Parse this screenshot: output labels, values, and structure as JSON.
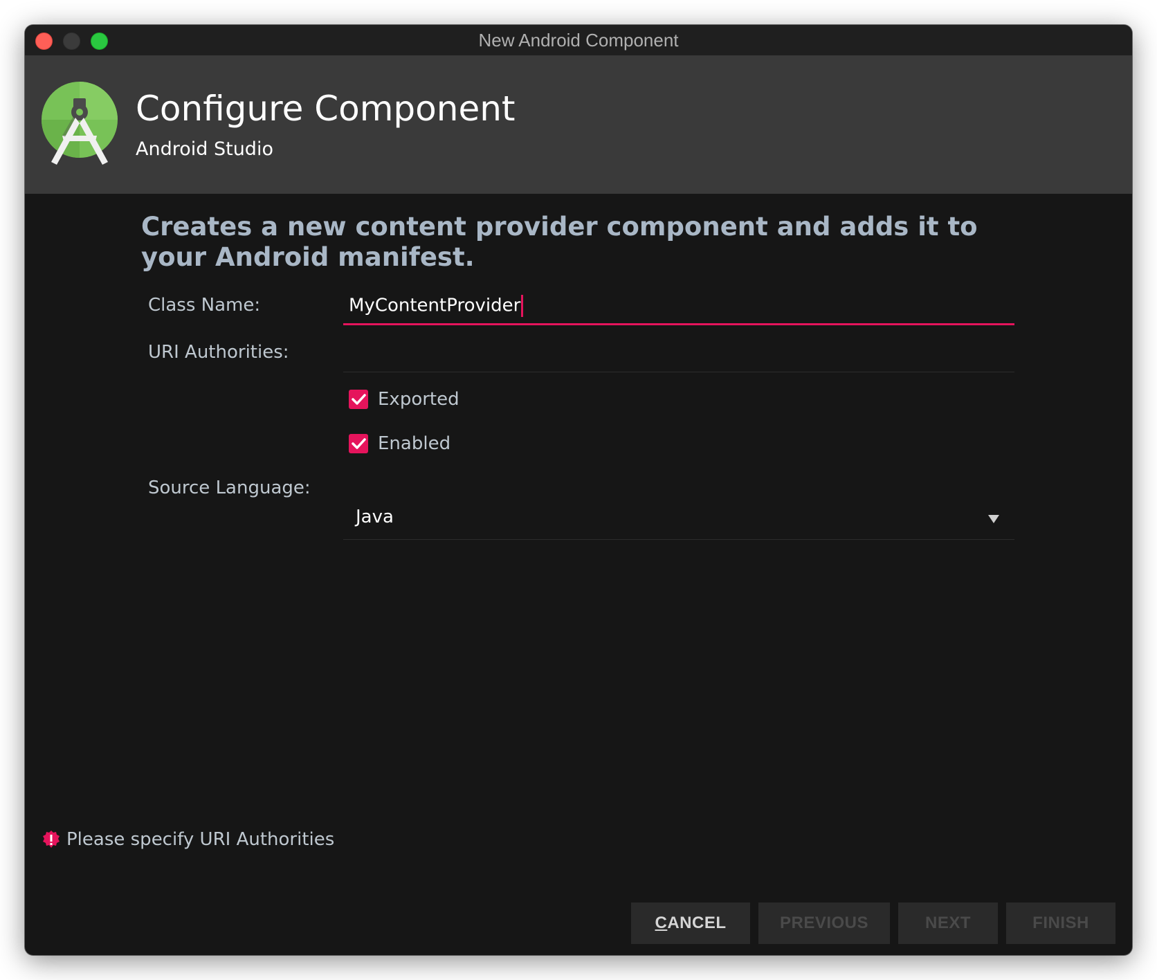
{
  "window": {
    "title": "New Android Component"
  },
  "header": {
    "title": "Configure Component",
    "subtitle": "Android Studio",
    "logo_icon": "android-studio-logo-icon"
  },
  "description": "Creates a new content provider component and adds it to your Android manifest.",
  "form": {
    "class_name": {
      "label": "Class Name:",
      "value": "MyContentProvider"
    },
    "uri_authorities": {
      "label": "URI Authorities:",
      "value": ""
    },
    "exported": {
      "label": "Exported",
      "checked": true
    },
    "enabled": {
      "label": "Enabled",
      "checked": true
    },
    "source_language": {
      "label": "Source Language:",
      "value": "Java"
    }
  },
  "error": {
    "icon": "error-icon",
    "message": "Please specify URI Authorities"
  },
  "buttons": {
    "cancel_mnemonic": "C",
    "cancel_rest": "ANCEL",
    "previous": "PREVIOUS",
    "next": "NEXT",
    "finish": "FINISH"
  },
  "colors": {
    "accent": "#e5145c",
    "background": "#161616",
    "header_background": "#3a3a3a",
    "description_text": "#a9b7c6"
  }
}
